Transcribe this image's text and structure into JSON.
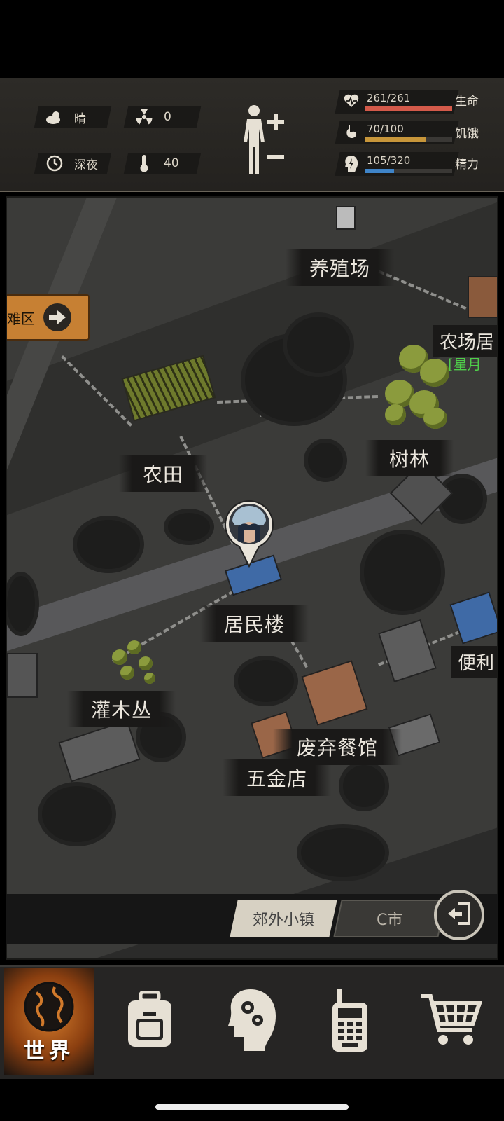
{
  "status": {
    "weather": "晴",
    "radiation": "0",
    "time_of_day": "深夜",
    "temperature": "40",
    "icons": [
      "cloud-sun-icon",
      "radiation-icon",
      "clock-icon",
      "thermometer-icon",
      "body-icon"
    ]
  },
  "vitals": [
    {
      "name": "生命",
      "value": "261/261",
      "level": 1.0,
      "color": "#d35a4a",
      "icon": "heart-pulse-icon"
    },
    {
      "name": "饥饿",
      "value": "70/100",
      "level": 0.7,
      "color": "#c7963a",
      "icon": "stomach-icon"
    },
    {
      "name": "精力",
      "value": "105/320",
      "level": 0.33,
      "color": "#3f84c8",
      "icon": "energy-head-icon"
    }
  ],
  "map": {
    "shelter_button": "难区",
    "locations": {
      "farm_breeding": "养殖场",
      "farmhouse": "农场居",
      "farmhouse_tag": "[星月",
      "farmland": "农田",
      "woods": "树林",
      "residential": "居民楼",
      "convenience": "便利",
      "shrubs": "灌木丛",
      "restaurant": "废弃餐馆",
      "hardware": "五金店"
    }
  },
  "regions": {
    "tab1": "郊外小镇",
    "tab2": "C市"
  },
  "nav": {
    "world": "世界",
    "items": [
      "globe-icon",
      "backpack-icon",
      "brain-gear-icon",
      "walkie-talkie-icon",
      "cart-icon"
    ]
  }
}
